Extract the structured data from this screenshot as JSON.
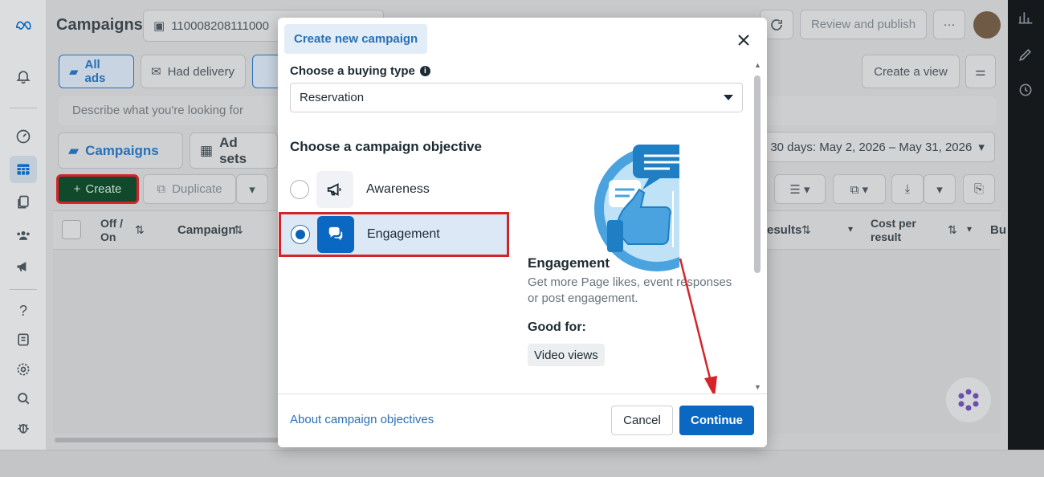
{
  "header": {
    "title": "Campaigns",
    "account_id": "110008208111000",
    "review_publish": "Review and publish",
    "more": "···"
  },
  "filters": {
    "all_ads": "All ads",
    "had_delivery": "Had delivery",
    "create_view": "Create a view",
    "search_placeholder": "Describe what you're looking for"
  },
  "tabs": {
    "campaigns": "Campaigns",
    "ad_sets": "Ad sets"
  },
  "date_range": "t 30 days: May 2, 2026 – May 31, 2026",
  "toolbar": {
    "create": "Create",
    "duplicate": "Duplicate"
  },
  "table": {
    "col_off_on": "Off / On",
    "col_campaign": "Campaign",
    "col_results": "esults",
    "col_cost_per_result": "Cost per result",
    "col_bu": "Bu"
  },
  "modal": {
    "tag": "Create new campaign",
    "buying_type_label": "Choose a buying type",
    "buying_type_value": "Reservation",
    "objective_label": "Choose a campaign objective",
    "objectives": [
      {
        "label": "Awareness",
        "selected": false,
        "icon": "megaphone-icon"
      },
      {
        "label": "Engagement",
        "selected": true,
        "icon": "chat-bubbles-icon"
      }
    ],
    "detail": {
      "title": "Engagement",
      "description": "Get more Page likes, event responses or post engagement.",
      "good_for_label": "Good for:",
      "good_for_tag": "Video views"
    },
    "about_link": "About campaign objectives",
    "cancel": "Cancel",
    "continue": "Continue"
  },
  "colors": {
    "accent": "#0a67c2",
    "highlight_border": "#d6232a",
    "selected_row_bg": "#dce8f5",
    "create_button_bg": "#0f4d2b"
  }
}
